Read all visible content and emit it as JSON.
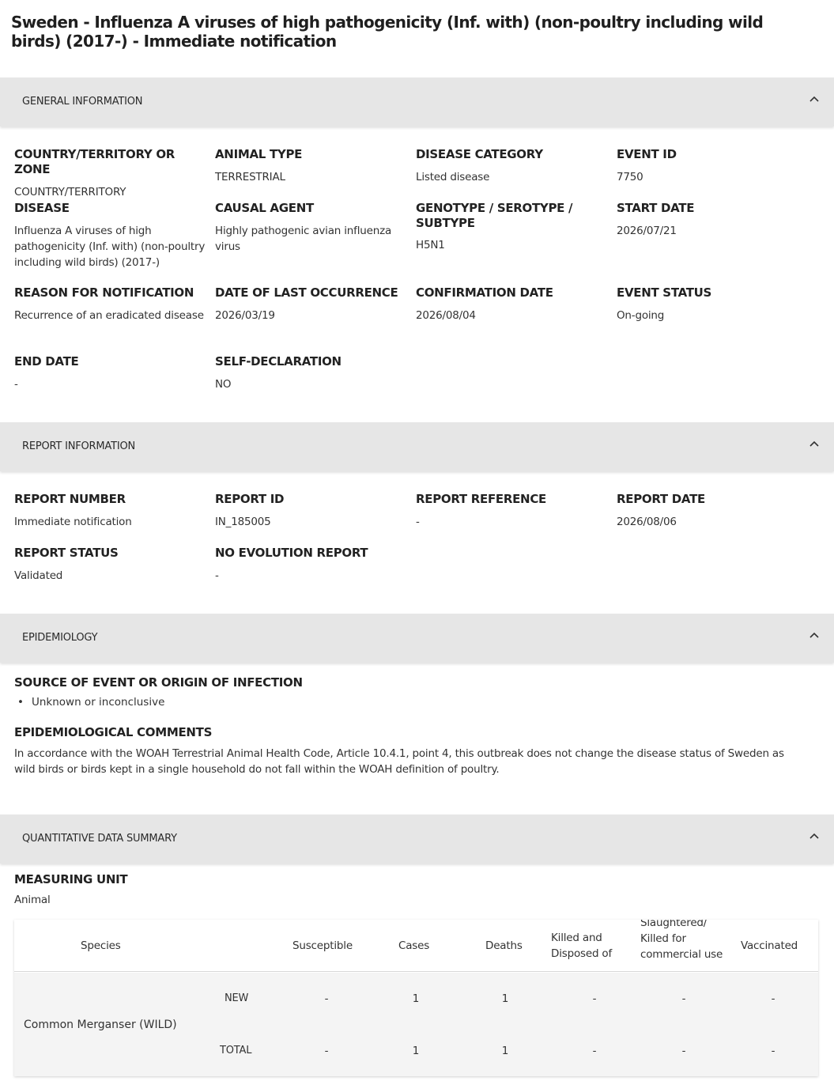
{
  "title": "Sweden - Influenza A viruses of high pathogenicity (Inf. with) (non-poultry including wild birds) (2017-) - Immediate notification",
  "sections": {
    "general": "GENERAL INFORMATION",
    "report": "REPORT INFORMATION",
    "epi": "EPIDEMIOLOGY",
    "quant": "QUANTITATIVE DATA SUMMARY"
  },
  "general": {
    "country_lbl": "COUNTRY/TERRITORY OR ZONE",
    "country_val": "COUNTRY/TERRITORY",
    "animal_lbl": "ANIMAL TYPE",
    "animal_val": "TERRESTRIAL",
    "category_lbl": "DISEASE CATEGORY",
    "category_val": "Listed disease",
    "event_id_lbl": "EVENT ID",
    "event_id_val": "7750",
    "disease_lbl": "DISEASE",
    "disease_val": "Influenza A viruses of high pathogenicity (Inf. with) (non-poultry including wild birds) (2017-)",
    "agent_lbl": "CAUSAL AGENT",
    "agent_val": "Highly pathogenic avian influenza virus",
    "genotype_lbl": "GENOTYPE / SEROTYPE / SUBTYPE",
    "genotype_val": "H5N1",
    "start_lbl": "START DATE",
    "start_val": "2026/07/21",
    "reason_lbl": "REASON FOR NOTIFICATION",
    "reason_val": "Recurrence of an eradicated disease",
    "last_occ_lbl": "DATE OF LAST OCCURRENCE",
    "last_occ_val": "2026/03/19",
    "confirm_lbl": "CONFIRMATION DATE",
    "confirm_val": "2026/08/04",
    "status_lbl": "EVENT STATUS",
    "status_val": "On-going",
    "end_lbl": "END DATE",
    "end_val": "-",
    "selfdecl_lbl": "SELF-DECLARATION",
    "selfdecl_val": "NO"
  },
  "report": {
    "number_lbl": "REPORT NUMBER",
    "number_val": "Immediate notification",
    "id_lbl": "REPORT ID",
    "id_val": "IN_185005",
    "ref_lbl": "REPORT REFERENCE",
    "ref_val": "-",
    "date_lbl": "REPORT DATE",
    "date_val": "2026/08/06",
    "status_lbl": "REPORT STATUS",
    "status_val": "Validated",
    "noevo_lbl": "NO EVOLUTION REPORT",
    "noevo_val": "-"
  },
  "epi": {
    "source_lbl": "SOURCE OF EVENT OR ORIGIN OF INFECTION",
    "source_item": "Unknown or inconclusive",
    "comments_lbl": "EPIDEMIOLOGICAL COMMENTS",
    "comments_val": "In accordance with the WOAH Terrestrial Animal Health Code, Article 10.4.1, point 4, this outbreak does not change the disease status of Sweden as wild birds or birds kept in a single household do not fall within the WOAH definition of poultry."
  },
  "quant": {
    "unit_lbl": "MEASURING UNIT",
    "unit_val": "Animal",
    "headers": {
      "species": "Species",
      "susceptible": "Susceptible",
      "cases": "Cases",
      "deaths": "Deaths",
      "killed": "Killed and Disposed of",
      "slaughtered": "Slaughtered/ Killed for commercial use",
      "vaccinated": "Vaccinated"
    },
    "species_name": "Common Merganser (WILD)",
    "rows": [
      {
        "label": "NEW",
        "susceptible": "-",
        "cases": "1",
        "deaths": "1",
        "killed": "-",
        "slaughtered": "-",
        "vaccinated": "-"
      },
      {
        "label": "TOTAL",
        "susceptible": "-",
        "cases": "1",
        "deaths": "1",
        "killed": "-",
        "slaughtered": "-",
        "vaccinated": "-"
      }
    ]
  }
}
